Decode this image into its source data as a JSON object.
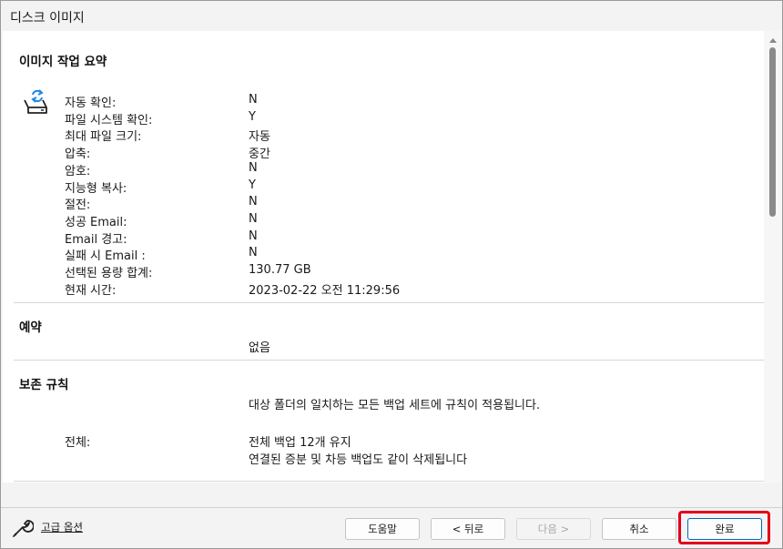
{
  "window": {
    "title": "디스크 이미지"
  },
  "summary": {
    "title": "이미지 작업 요약",
    "rows": [
      {
        "label": "자동 확인:",
        "value": "N"
      },
      {
        "label": "파일 시스템 확인:",
        "value": "Y"
      },
      {
        "label": "최대 파일 크기:",
        "value": "자동"
      },
      {
        "label": "압축:",
        "value": "중간"
      },
      {
        "label": "암호:",
        "value": "N"
      },
      {
        "label": "지능형 복사:",
        "value": "Y"
      },
      {
        "label": "절전:",
        "value": "N"
      },
      {
        "label": "성공 Email:",
        "value": "N"
      },
      {
        "label": "Email 경고:",
        "value": "N"
      },
      {
        "label": "실패 시 Email :",
        "value": "N"
      },
      {
        "label": "선택된 용량 합계:",
        "value": "130.77 GB"
      },
      {
        "label": "현재 시간:",
        "value": "2023-02-22 오전 11:29:56"
      }
    ]
  },
  "schedule": {
    "title": "예약",
    "value": "없음"
  },
  "retention": {
    "title": "보존 규칙",
    "description": "대상 폴더의 일치하는 모든 백업 세트에 규칙이 적용됩니다.",
    "label": "전체:",
    "line1": "전체 백업 12개 유지",
    "line2": "연결된 증분 및 차등 백업도 같이 삭제됩니다"
  },
  "footer": {
    "advanced_label": "고급 옵션",
    "help": "도움말",
    "back": "< 뒤로",
    "next": "다음 >",
    "cancel": "취소",
    "finish": "완료"
  },
  "colors": {
    "highlight": "#e3001b",
    "accent": "#0067c0",
    "icon_arrow": "#1e88e5"
  }
}
